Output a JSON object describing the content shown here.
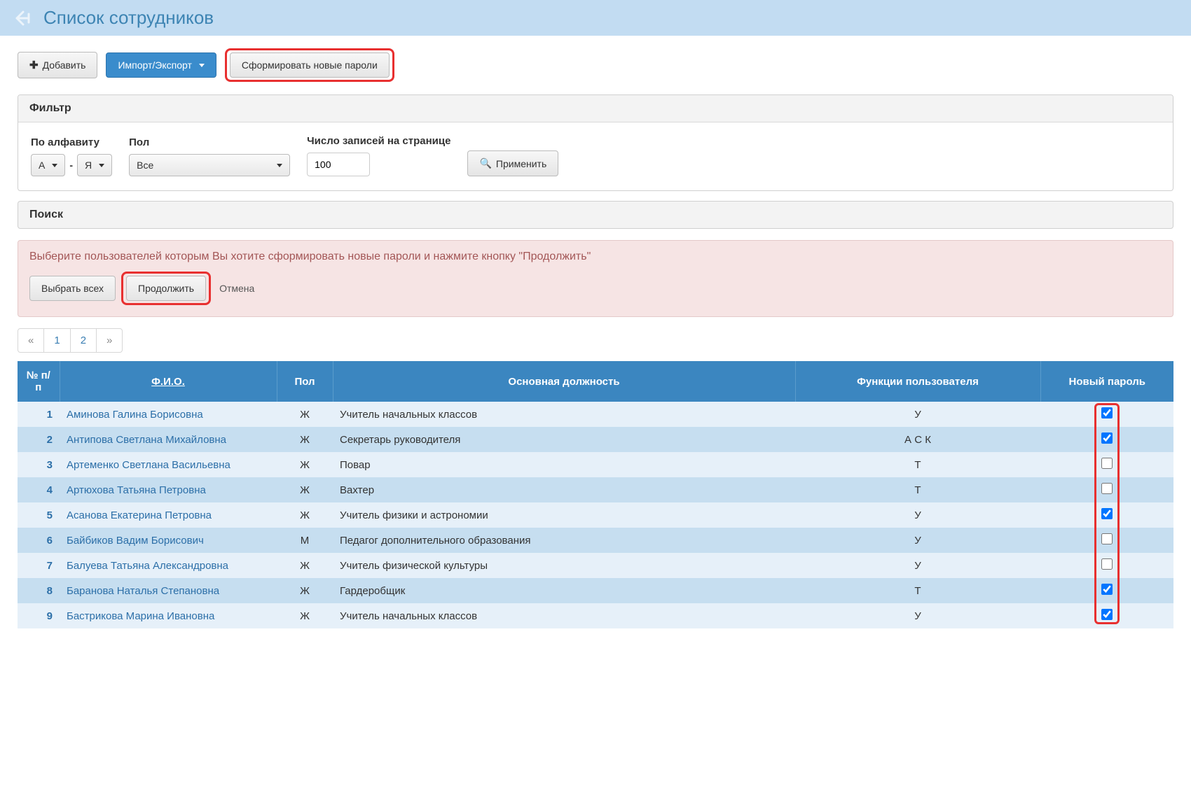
{
  "header": {
    "title": "Список сотрудников"
  },
  "toolbar": {
    "add_label": "Добавить",
    "import_export_label": "Импорт/Экспорт",
    "generate_passwords_label": "Сформировать новые пароли"
  },
  "filter": {
    "panel_title": "Фильтр",
    "alphabet_label": "По алфавиту",
    "alphabet_from": "А",
    "alphabet_to": "Я",
    "gender_label": "Пол",
    "gender_value": "Все",
    "perpage_label": "Число записей на странице",
    "perpage_value": "100",
    "apply_label": "Применить"
  },
  "search": {
    "panel_title": "Поиск"
  },
  "alert": {
    "text": "Выберите пользователей которым Вы хотите сформировать новые пароли и нажмите кнопку \"Продолжить\"",
    "select_all": "Выбрать всех",
    "continue": "Продолжить",
    "cancel": "Отмена"
  },
  "pagination": {
    "prev": "«",
    "p1": "1",
    "p2": "2",
    "next": "»"
  },
  "table": {
    "col_num": "№ п/п",
    "col_fio": "Ф.И.О.",
    "col_gender": "Пол",
    "col_position": "Основная должность",
    "col_func": "Функции пользователя",
    "col_pwd": "Новый пароль",
    "rows": [
      {
        "n": "1",
        "fio": "Аминова Галина Борисовна",
        "g": "Ж",
        "pos": "Учитель начальных классов",
        "f": "У",
        "chk": true
      },
      {
        "n": "2",
        "fio": "Антипова Светлана Михайловна",
        "g": "Ж",
        "pos": "Секретарь руководителя",
        "f": "А С К",
        "chk": true
      },
      {
        "n": "3",
        "fio": "Артеменко Светлана Васильевна",
        "g": "Ж",
        "pos": "Повар",
        "f": "Т",
        "chk": false
      },
      {
        "n": "4",
        "fio": "Артюхова Татьяна Петровна",
        "g": "Ж",
        "pos": "Вахтер",
        "f": "Т",
        "chk": false
      },
      {
        "n": "5",
        "fio": "Асанова Екатерина Петровна",
        "g": "Ж",
        "pos": "Учитель физики и астрономии",
        "f": "У",
        "chk": true
      },
      {
        "n": "6",
        "fio": "Байбиков Вадим Борисович",
        "g": "М",
        "pos": "Педагог дополнительного образования",
        "f": "У",
        "chk": false
      },
      {
        "n": "7",
        "fio": "Балуева Татьяна Александровна",
        "g": "Ж",
        "pos": "Учитель физической культуры",
        "f": "У",
        "chk": false
      },
      {
        "n": "8",
        "fio": "Баранова Наталья Степановна",
        "g": "Ж",
        "pos": "Гардеробщик",
        "f": "Т",
        "chk": true
      },
      {
        "n": "9",
        "fio": "Бастрикова Марина Ивановна",
        "g": "Ж",
        "pos": "Учитель начальных классов",
        "f": "У",
        "chk": true
      }
    ]
  }
}
